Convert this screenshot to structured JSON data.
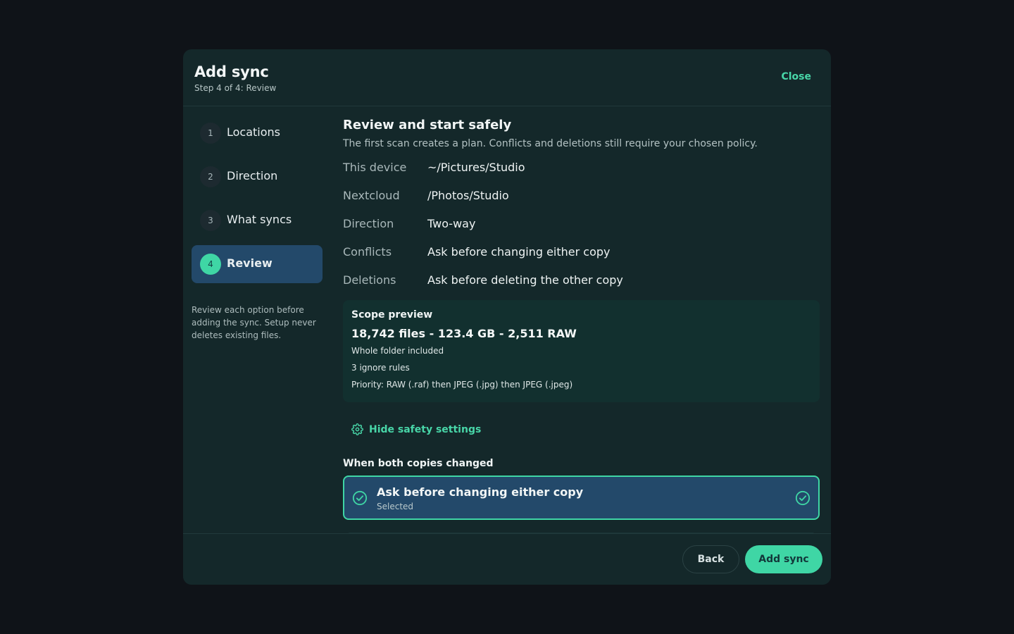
{
  "dialog": {
    "title": "Add sync",
    "subtitle": "Step 4 of 4: Review",
    "close_label": "Close"
  },
  "steps": [
    {
      "num": "1",
      "label": "Locations",
      "active": false
    },
    {
      "num": "2",
      "label": "Direction",
      "active": false
    },
    {
      "num": "3",
      "label": "What syncs",
      "active": false
    },
    {
      "num": "4",
      "label": "Review",
      "active": true
    }
  ],
  "sidebar_note": "Review each option before adding the sync. Setup never deletes existing files.",
  "review": {
    "title": "Review and start safely",
    "description": "The first scan creates a plan. Conflicts and deletions still require your chosen policy.",
    "rows": [
      {
        "key": "This device",
        "value": "~/Pictures/Studio"
      },
      {
        "key": "Nextcloud",
        "value": "/Photos/Studio"
      },
      {
        "key": "Direction",
        "value": "Two-way"
      },
      {
        "key": "Conflicts",
        "value": "Ask before changing either copy"
      },
      {
        "key": "Deletions",
        "value": "Ask before deleting the other copy"
      }
    ]
  },
  "scope": {
    "title": "Scope preview",
    "stats": "18,742 files - 123.4 GB - 2,511 RAW",
    "lines": [
      "Whole folder included",
      "3 ignore rules",
      "Priority: RAW (.raf) then JPEG (.jpg) then JPEG (.jpeg)"
    ]
  },
  "safety": {
    "toggle_label": "Hide safety settings",
    "icon": "gear-icon",
    "policy_title": "When both copies changed",
    "selected_option": {
      "label": "Ask before changing either copy",
      "sublabel": "Selected",
      "icon": "check-circle-icon"
    }
  },
  "footer": {
    "back_label": "Back",
    "add_label": "Add sync"
  },
  "colors": {
    "accent": "#3fd6a5",
    "active_bg": "#23496a",
    "dialog_bg": "#14282a",
    "page_bg": "#0f1318"
  }
}
